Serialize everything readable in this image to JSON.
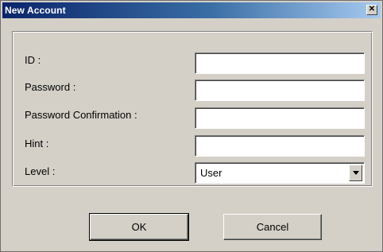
{
  "window": {
    "title": "New Account",
    "close_glyph": "✕",
    "icon_close": "close-icon"
  },
  "form": {
    "id_label": "ID :",
    "password_label": "Password :",
    "password_confirm_label": "Password Confirmation :",
    "hint_label": "Hint :",
    "level_label": "Level :",
    "id_value": "",
    "password_value": "",
    "password_confirm_value": "",
    "hint_value": "",
    "level_value": "User"
  },
  "buttons": {
    "ok": "OK",
    "cancel": "Cancel"
  },
  "colors": {
    "titlebar_start": "#0a246a",
    "titlebar_end": "#a6caf0",
    "face": "#d4d0c8"
  }
}
